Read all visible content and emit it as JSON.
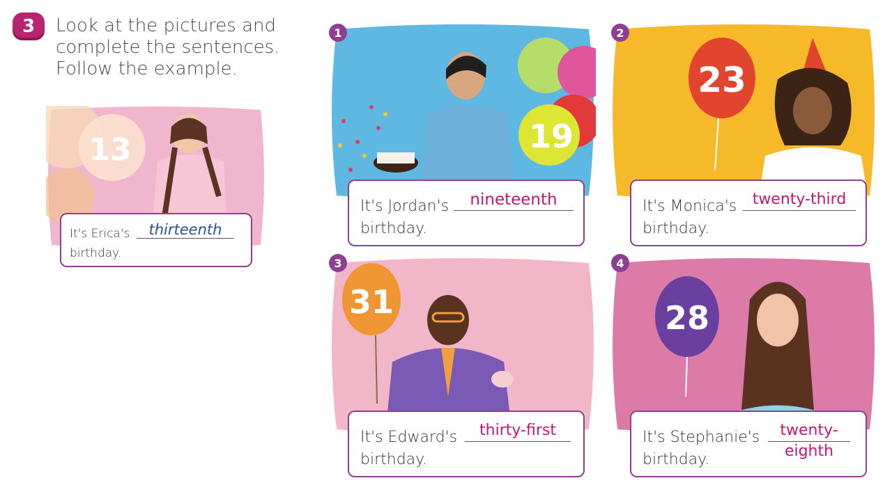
{
  "exercise": {
    "number": "3",
    "instruction_lines": [
      "Look at the pictures and",
      "complete the sentences.",
      "Follow the example."
    ]
  },
  "example": {
    "prefix": "It's Erica's",
    "answer": "thirteenth",
    "suffix": "birthday.",
    "balloon": "13"
  },
  "items": [
    {
      "number": "1",
      "prefix": "It's Jordan's",
      "answer": "nineteenth",
      "suffix": "birthday.",
      "balloon": "19"
    },
    {
      "number": "2",
      "prefix": "It's Monica's",
      "answer": "twenty-third",
      "suffix": "birthday.",
      "balloon": "23"
    },
    {
      "number": "3",
      "prefix": "It's Edward's",
      "answer": "thirty-first",
      "suffix": "birthday.",
      "balloon": "31"
    },
    {
      "number": "4",
      "prefix": "It's Stephanie's",
      "answer_line1": "twenty-",
      "answer_line2": "eighth",
      "suffix": "birthday.",
      "balloon": "28"
    }
  ],
  "colors": {
    "accent": "#8e3f8f",
    "answer": "#c0167a",
    "example_answer": "#2d4f8f",
    "badge": "#b7246f"
  }
}
